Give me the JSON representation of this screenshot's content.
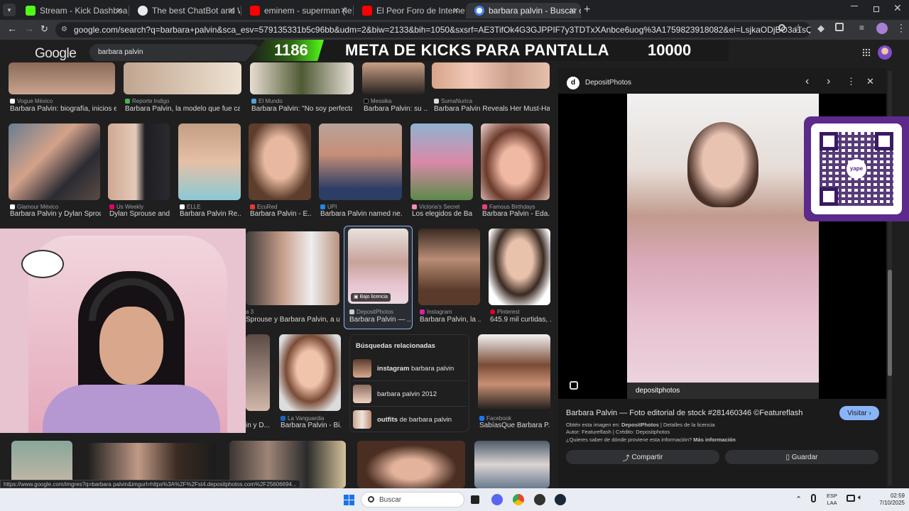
{
  "tabs": [
    {
      "title": "Stream - Kick Dashboard",
      "fav_color": "#53fc18"
    },
    {
      "title": "The best ChatBot and Widgets",
      "fav_color": "#e8eaed"
    },
    {
      "title": "eminem - superman (letra espa",
      "fav_color": "#ff0000"
    },
    {
      "title": "El Peor Foro de Internet: GC - Y",
      "fav_color": "#ff0000"
    },
    {
      "title": "barbara palvin - Buscar con Go",
      "fav_color": "#4285f4"
    }
  ],
  "new_tab_glyph": "+",
  "url": "google.com/search?q=barbara+palvin&sca_esv=579135331b5c96bb&udm=2&biw=2133&bih=1050&sxsrf=AE3TifOk4G3GJPPIF7y3TDTxXAnbce6uog%3A1759823918082&ei=LsjkaODjBO3a1sQPrNSXyQw&oq=BARBARA&gs_lp=Egtnd3M...",
  "google": {
    "logo": "Google",
    "search_value": "barbara palvin"
  },
  "banner": {
    "count": "1186",
    "text": "META DE KICKS PARA PANTALLA",
    "goal": "10000"
  },
  "row1": [
    {
      "source": "Vogue México",
      "caption": "Barbara Palvin: biografía, inicios en ..."
    },
    {
      "source": "Reporte Indigo",
      "caption": "Barbara Palvin, la modelo que fue catal..."
    },
    {
      "source": "El Mundo",
      "caption": "Barbara Palvin: \"No soy perfecta, ..."
    },
    {
      "source": "Messika",
      "caption": "Barbara Palvin: su ..."
    },
    {
      "source": "SumaNurica",
      "caption": "Barbara Palvin Reveals Her Must-Have..."
    }
  ],
  "row2": [
    {
      "source": "Glamour México",
      "caption": "Barbara Palvin y Dylan Sprou..."
    },
    {
      "source": "Us Weekly",
      "caption": "Dylan Sprouse and..."
    },
    {
      "source": "ELLE",
      "caption": "Barbara Palvin Re..."
    },
    {
      "source": "EcuRed",
      "caption": "Barbara Palvin - E..."
    },
    {
      "source": "UPI",
      "caption": "Barbara Palvin named ne..."
    },
    {
      "source": "Victoria's Secret",
      "caption": "Los elegidos de Ba..."
    },
    {
      "source": "Famous Birthdays",
      "caption": "Barbara Palvin - Eda..."
    }
  ],
  "row3": [
    {
      "source": "a 3",
      "caption": "Sprouse y Barbara Palvin, a un ..."
    },
    {
      "source": "DepositPhotos",
      "caption": "Barbara Palvin — ...",
      "badge": "Bajo licencia"
    },
    {
      "source": "Instagram",
      "caption": "Barbara Palvin, la ..."
    },
    {
      "source": "Pinterest",
      "caption": "645.9 mil curtidas, ..."
    }
  ],
  "row4": [
    {
      "source": "",
      "caption": "in y D..."
    },
    {
      "source": "La Vanguardia",
      "caption": "Barbara Palvin - Bi..."
    },
    {
      "source": "Facebook",
      "caption": "SabíasQue Barbara P..."
    }
  ],
  "related": {
    "title": "Búsquedas relacionadas",
    "items": [
      {
        "bold": "instagram",
        "rest": " barbara palvin"
      },
      {
        "bold": "",
        "rest": "barbara palvin 2012"
      },
      {
        "bold": "outfits",
        "rest": " de barbara palvin"
      }
    ]
  },
  "panel": {
    "site": "DepositPhotos",
    "title": "Barbara Palvin — Foto editorial de stock #281460346 ©Featureflash",
    "visit": "Visitar",
    "obtained_prefix": "Obtén esta imagen en: ",
    "obtained_site": "DepositPhotos",
    "license": " | Detalles de la licencia",
    "author": "Autor: Featureflash | Crédito: Depositphotos",
    "question": "¿Quieres saber de dónde proviene esta información?",
    "more_info": "Más información",
    "share": "Compartir",
    "save": "Guardar",
    "watermark": "depositphotos"
  },
  "qr": {
    "brand": "yape"
  },
  "status_url": "https://www.google.com/imgres?q=barbara palvin&imgurl=https%3A%2F%2Fst4.depositphotos.com%2F25606694...",
  "taskbar": {
    "search_placeholder": "Buscar",
    "lang_top": "ESP",
    "lang_bottom": "LAA",
    "time": "02:59",
    "date": "7/10/2025"
  },
  "colors": {
    "accent_blue": "#8ab4f8",
    "kick_green": "#53fc18",
    "panel_bg": "#1b1b1b"
  }
}
